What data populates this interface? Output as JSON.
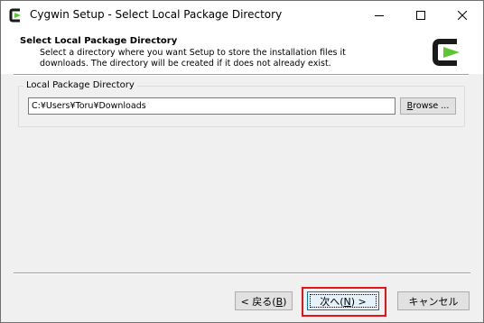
{
  "window": {
    "title": "Cygwin Setup - Select Local Package Directory",
    "icon": "cygwin-logo-icon",
    "controls": {
      "minimize": "minimize-icon",
      "maximize": "maximize-icon",
      "close": "close-icon"
    }
  },
  "header": {
    "title": "Select Local Package Directory",
    "description_line1": "Select a directory where you want Setup to store the installation files it",
    "description_line2": "downloads.  The directory will be created if it does not already exist.",
    "logo": "cygwin-logo-icon"
  },
  "local_package": {
    "group_label": "Local Package Directory",
    "directory_value": "C:¥Users¥Toru¥Downloads",
    "browse_label_pre": "",
    "browse_label_accel": "B",
    "browse_label_post": "rowse ..."
  },
  "footer": {
    "back_label_pre": "< 戻る(",
    "back_label_accel": "B",
    "back_label_post": ")",
    "next_label_pre": "次へ(",
    "next_label_accel": "N",
    "next_label_post": ") >",
    "cancel_label": "キャンセル"
  },
  "colors": {
    "highlight": "#e8121a",
    "focus_border": "#0078d7",
    "logo_green": "#5ec630",
    "logo_dark": "#1a1a1a"
  }
}
